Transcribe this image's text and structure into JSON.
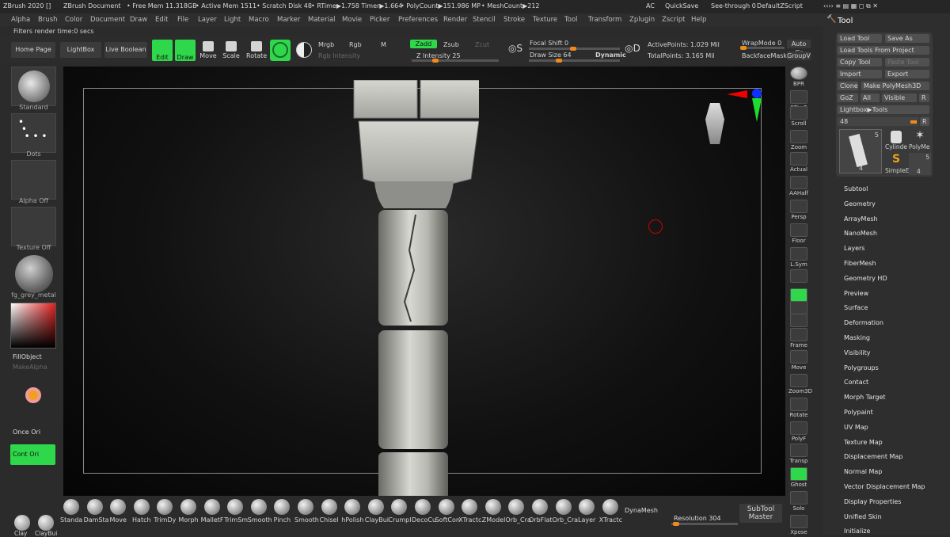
{
  "titlebar": {
    "app": "ZBrush 2020 []",
    "document": "ZBrush Document",
    "free_mem": "• Free Mem 11.318GB",
    "active_mem": "• Active Mem 1511",
    "scratch": "• Scratch Disk 48",
    "rtime": "• RTime▶1.758 Timer▶1.664",
    "polycount": "• PolyCount▶151.986 MP",
    "meshcount": "• MeshCount▶212",
    "ac": "AC",
    "quicksave": "QuickSave",
    "seethrough": "See-through  0",
    "script": "DefaultZScript"
  },
  "menubar": [
    "Alpha",
    "Brush",
    "Color",
    "Document",
    "Draw",
    "Edit",
    "File",
    "Layer",
    "Light",
    "Macro",
    "Marker",
    "Material",
    "Movie",
    "Picker",
    "Preferences",
    "Render",
    "Stencil",
    "Stroke",
    "Texture",
    "Tool",
    "Transform",
    "Zplugin",
    "Zscript",
    "Help"
  ],
  "status": "Filters render time:0 secs",
  "toolbar": {
    "home": "Home Page",
    "lightbox": "LightBox",
    "liveboolean": "Live Boolean",
    "edit": "Edit",
    "draw": "Draw",
    "move": "Move",
    "scale": "Scale",
    "rotate": "Rotate",
    "mrgb": "Mrgb",
    "rgb": "Rgb",
    "m": "M",
    "rgb_intensity": "Rgb Intensity",
    "zadd": "Zadd",
    "zsub": "Zsub",
    "zcut": "Zcut",
    "z_intensity": "Z Intensity 25",
    "z_intensity_frac": 0.25,
    "focal_shift": "Focal Shift 0",
    "draw_size": "Draw Size 64",
    "dynamic": "Dynamic",
    "active_points": "ActivePoints: 1.029 Mil",
    "total_points": "TotalPoints: 3.165 Mil",
    "wrapmode": "WrapMode 0",
    "backface": "BackfaceMask",
    "autogr": "Auto Gr",
    "groupv": "GroupV"
  },
  "left": {
    "standard": "Standard",
    "dots": "Dots",
    "alpha": "Alpha Off",
    "texture": "Texture Off",
    "material": "fg_grey_metal",
    "fillobject": "FillObject",
    "makealpha": "MakeAlpha",
    "onceori": "Once Ori",
    "contori": "Cont Ori"
  },
  "shelf": [
    "BPR",
    "SPix 3",
    "Scroll",
    "Zoom",
    "Actual",
    "AAHalf",
    "Persp",
    "Floor",
    "L.Sym",
    "",
    "Xyz",
    "",
    "",
    "Frame",
    "Move",
    "Zoom3D",
    "Rotate",
    "PolyF",
    "Transp",
    "Ghost",
    "Solo",
    "Xpose"
  ],
  "tool": {
    "title": "Tool",
    "load_tool": "Load Tool",
    "save_as": "Save As",
    "load_from_project": "Load Tools From Project",
    "copy_tool": "Copy Tool",
    "paste_tool": "Paste Tool",
    "import": "Import",
    "export": "Export",
    "clone": "Clone",
    "make_polymesh": "Make PolyMesh3D",
    "goz": "GoZ",
    "all": "All",
    "visible": "Visible",
    "r": "R",
    "lightbox_tools": "Lightbox▶Tools",
    "count": "48",
    "thumb_count": "5",
    "thumb_bottom": "4",
    "cylinder": "Cylinde",
    "polyme": "PolyMe",
    "simple": "SimpleE",
    "thumb4": "4",
    "thumb5": "5",
    "items": [
      "Subtool",
      "Geometry",
      "ArrayMesh",
      "NanoMesh",
      "Layers",
      "FiberMesh",
      "Geometry HD",
      "Preview",
      "Surface",
      "Deformation",
      "Masking",
      "Visibility",
      "Polygroups",
      "Contact",
      "Morph Target",
      "Polypaint",
      "UV Map",
      "Texture Map",
      "Displacement Map",
      "Normal Map",
      "Vector Displacement Map",
      "Display Properties",
      "Unified Skin",
      "Initialize"
    ]
  },
  "bottom": {
    "brushes": [
      "Standa",
      "DamSta",
      "Move",
      "Hatch",
      "TrimDy",
      "Morph",
      "MalletF",
      "TrimSm",
      "Smooth",
      "Pinch",
      "Smooth",
      "Chisel",
      "hPolish",
      "ClayBui",
      "Crumpl",
      "DecoCu",
      "SoftCon",
      "XTractc",
      "ZModel",
      "Orb_Cra",
      "OrbFlat",
      "Orb_Cra",
      "Layer",
      "XTractc"
    ],
    "clay": "Clay",
    "claybui": "ClayBui",
    "dynamesh": "DynaMesh",
    "resolution": "Resolution 304",
    "subtool_master": "SubTool Master"
  },
  "colors": {
    "accent": "#2fd84a",
    "slider": "#f08a1c",
    "viewport": "#0a0a0a"
  }
}
